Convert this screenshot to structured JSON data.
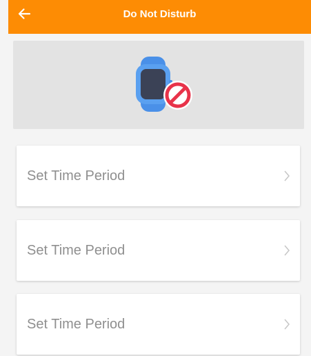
{
  "header": {
    "title": "Do Not Disturb",
    "back_icon": "arrow-left-icon",
    "color": "#fd8c04"
  },
  "banner": {
    "icon": "watch-do-not-disturb-icon",
    "background": "#e3e3e3"
  },
  "periods": [
    {
      "label": "Set Time Period",
      "icon": "chevron-right-icon"
    },
    {
      "label": "Set Time Period",
      "icon": "chevron-right-icon"
    },
    {
      "label": "Set Time Period",
      "icon": "chevron-right-icon"
    }
  ]
}
